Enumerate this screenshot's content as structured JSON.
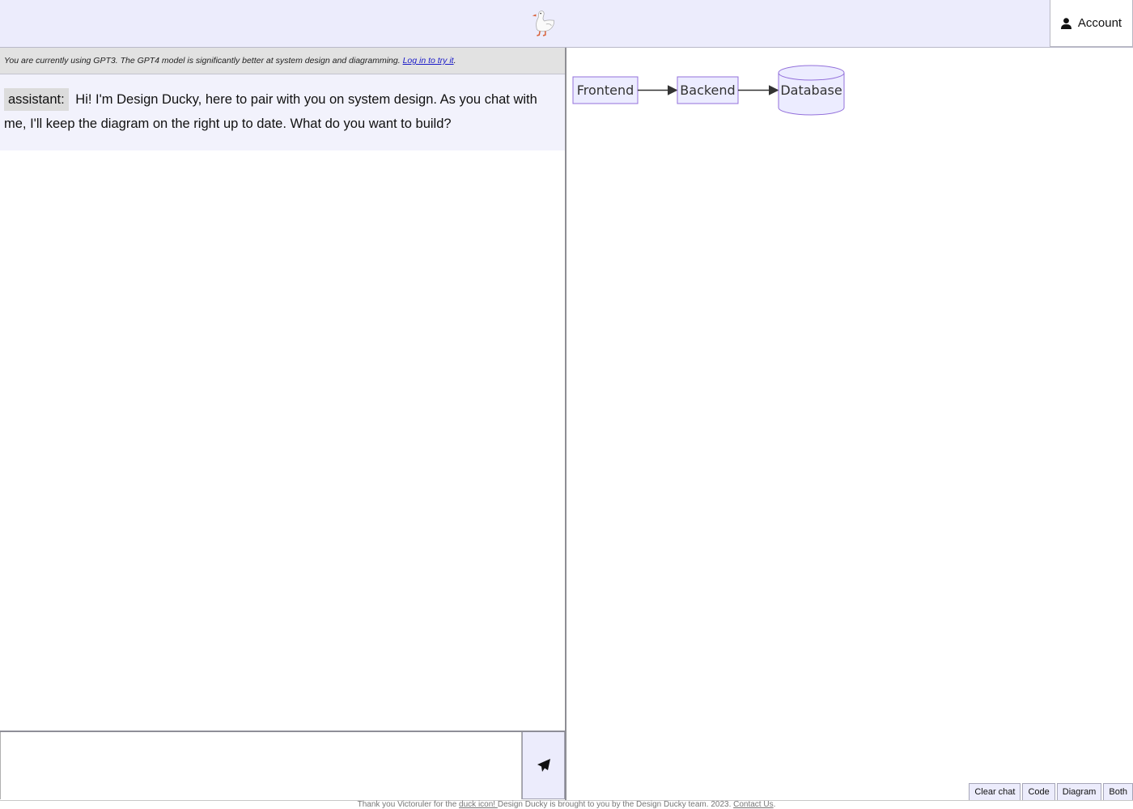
{
  "header": {
    "logo_alt": "duck-logo",
    "account_label": "Account"
  },
  "notice": {
    "text": "You are currently using GPT3. The GPT4 model is significantly better at system design and diagramming. ",
    "link_label": "Log in to try it",
    "suffix": "."
  },
  "messages": [
    {
      "role": "assistant:",
      "text": "Hi! I'm Design Ducky, here to pair with you on system design. As you chat with me, I'll keep the diagram on the right up to date. What do you want to build?"
    }
  ],
  "chat_input": {
    "value": "",
    "placeholder": ""
  },
  "diagram": {
    "nodes": [
      {
        "id": "frontend",
        "label": "Frontend",
        "shape": "rect"
      },
      {
        "id": "backend",
        "label": "Backend",
        "shape": "rect"
      },
      {
        "id": "database",
        "label": "Database",
        "shape": "cylinder"
      }
    ],
    "edges": [
      {
        "from": "frontend",
        "to": "backend"
      },
      {
        "from": "backend",
        "to": "database"
      }
    ],
    "colors": {
      "node_fill": "#ececff",
      "node_stroke": "#9370db",
      "edge": "#333333"
    }
  },
  "view_buttons": {
    "clear_chat": "Clear chat",
    "code": "Code",
    "diagram": "Diagram",
    "both": "Both"
  },
  "footer": {
    "thanks_prefix": "Thank you Victoruler for the ",
    "duck_link": "duck icon! ",
    "middle": "Design Ducky is brought to you by the Design Ducky team. 2023. ",
    "contact_link": "Contact Us",
    "suffix": "."
  }
}
